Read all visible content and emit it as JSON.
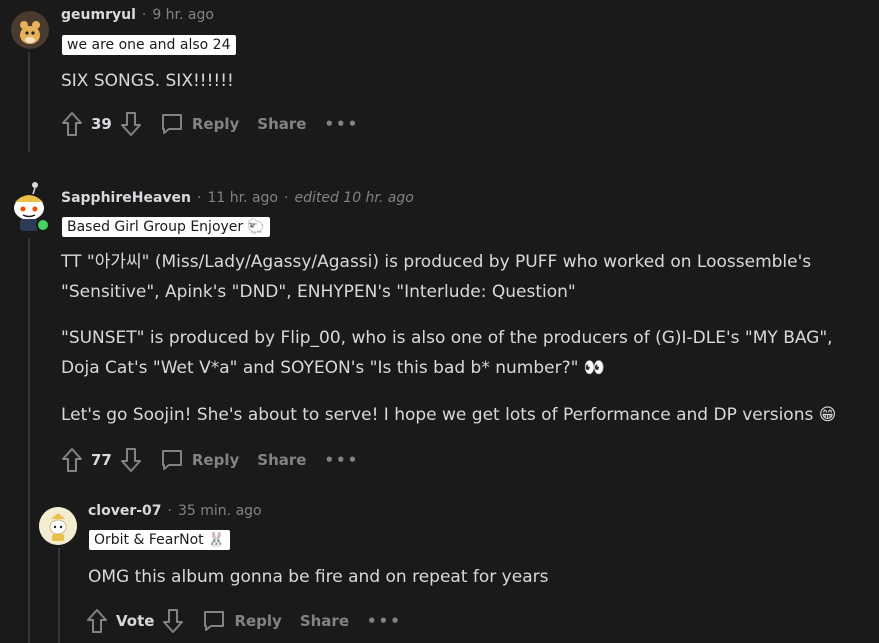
{
  "comments": [
    {
      "author": "geumryul",
      "time": "9 hr. ago",
      "flair": "we are one and also 24",
      "lines": [
        "SIX SONGS. SIX!!!!!!"
      ],
      "votes": "39",
      "reply": "Reply",
      "share": "Share",
      "more": "•••"
    },
    {
      "author": "SapphireHeaven",
      "time": "11 hr. ago",
      "edited": "edited 10 hr. ago",
      "flair": "Based Girl Group Enjoyer",
      "flair_emoji": "🐑",
      "lines": [
        "TT \"아가씨\" (Miss/Lady/Agassy/Agassi) is produced by PUFF who worked on Loossemble's",
        "\"Sensitive\", Apink's \"DND\", ENHYPEN's \"Interlude: Question\"",
        "\"SUNSET\" is produced by Flip_00, who is also one of the producers of (G)I-DLE's \"MY BAG\",",
        "Doja Cat's \"Wet V*a\" and SOYEON's \"Is this bad b* number?\" 👀",
        "Let's go Soojin! She's about to serve! I hope we get lots of Performance and DP versions 😁"
      ],
      "votes": "77",
      "reply": "Reply",
      "share": "Share",
      "more": "•••"
    },
    {
      "author": "clover-07",
      "time": "35 min. ago",
      "flair": "Orbit & FearNot",
      "flair_emoji": "🐰",
      "lines": [
        "OMG this album gonna be fire and on repeat for years"
      ],
      "votes": "Vote",
      "reply": "Reply",
      "share": "Share",
      "more": "•••"
    }
  ],
  "colors": {
    "background": "#1a1a1b",
    "text": "#d7dadc",
    "muted": "#818384",
    "online": "#46d160"
  }
}
